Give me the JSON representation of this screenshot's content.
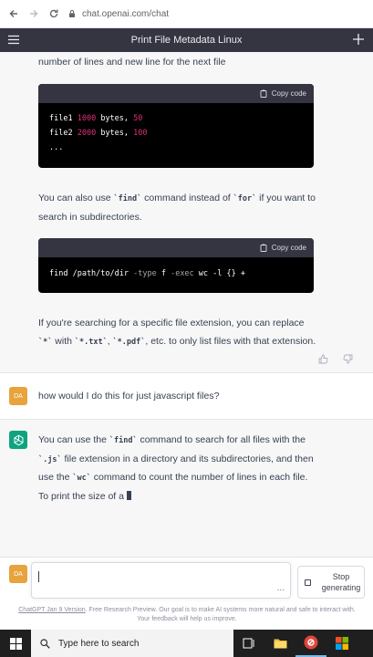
{
  "browser": {
    "url": "chat.openai.com/chat",
    "icons": [
      "back-arrow-icon",
      "forward-arrow-icon",
      "reload-icon",
      "lock-icon"
    ]
  },
  "header": {
    "title": "Print File Metadata Linux",
    "icons": [
      "hamburger-menu-icon",
      "plus-icon"
    ],
    "background": "#343541"
  },
  "assistant_1": {
    "intro": "number of lines and new line for the next file",
    "code_block_1": {
      "copy_label": "Copy code",
      "lines": [
        {
          "name": "file1",
          "num": "1000",
          "rest": " bytes, ",
          "num2": "50"
        },
        {
          "name": "file2",
          "num": "2000",
          "rest": " bytes, ",
          "num2": "100"
        }
      ],
      "last": "..."
    },
    "para_2": {
      "t1": "You can also use ",
      "c1": "`find`",
      "t2": " command instead of ",
      "c2": "`for`",
      "t3": " if you want to search in subdirectories."
    },
    "code_block_2": {
      "copy_label": "Copy code",
      "p1": "find /path/to/dir ",
      "p2": "-type",
      "p3": " f ",
      "p4": "-exec",
      "p5": " wc -l {} +"
    },
    "para_3": {
      "t1": "If you're searching for a specific file extension, you can replace ",
      "c1": "`*`",
      "t2": " with ",
      "c2": "`*.txt`",
      "t3": ", ",
      "c3": "`*.pdf`",
      "t4": ", etc. to only list files with that extension."
    }
  },
  "user_message": {
    "avatar": "DA",
    "text": "how would I do this for just javascript files?"
  },
  "assistant_2": {
    "t1": "You can use the ",
    "c1": "`find`",
    "t2": " command to search for all files with the ",
    "c2": "`.js`",
    "t3": " file extension in a directory and its subdirectories, and then use the ",
    "c3": "`wc`",
    "t4": " command to count the number of lines in each file. To print the size of a"
  },
  "input": {
    "avatar": "DA",
    "ellipsis": "...",
    "stop_label": "Stop generating"
  },
  "disclaimer": {
    "link": "ChatGPT Jan 9 Version",
    "text": ". Free Research Preview. Our goal is to make AI systems more natural and safe to interact with. Your feedback will help us improve."
  },
  "taskbar": {
    "search_placeholder": "Type here to search"
  },
  "colors": {
    "avatar_user": "#e8a33d",
    "avatar_gpt": "#10a37f",
    "code_number": "#df3079",
    "taskbar": "#1f1f1f"
  }
}
